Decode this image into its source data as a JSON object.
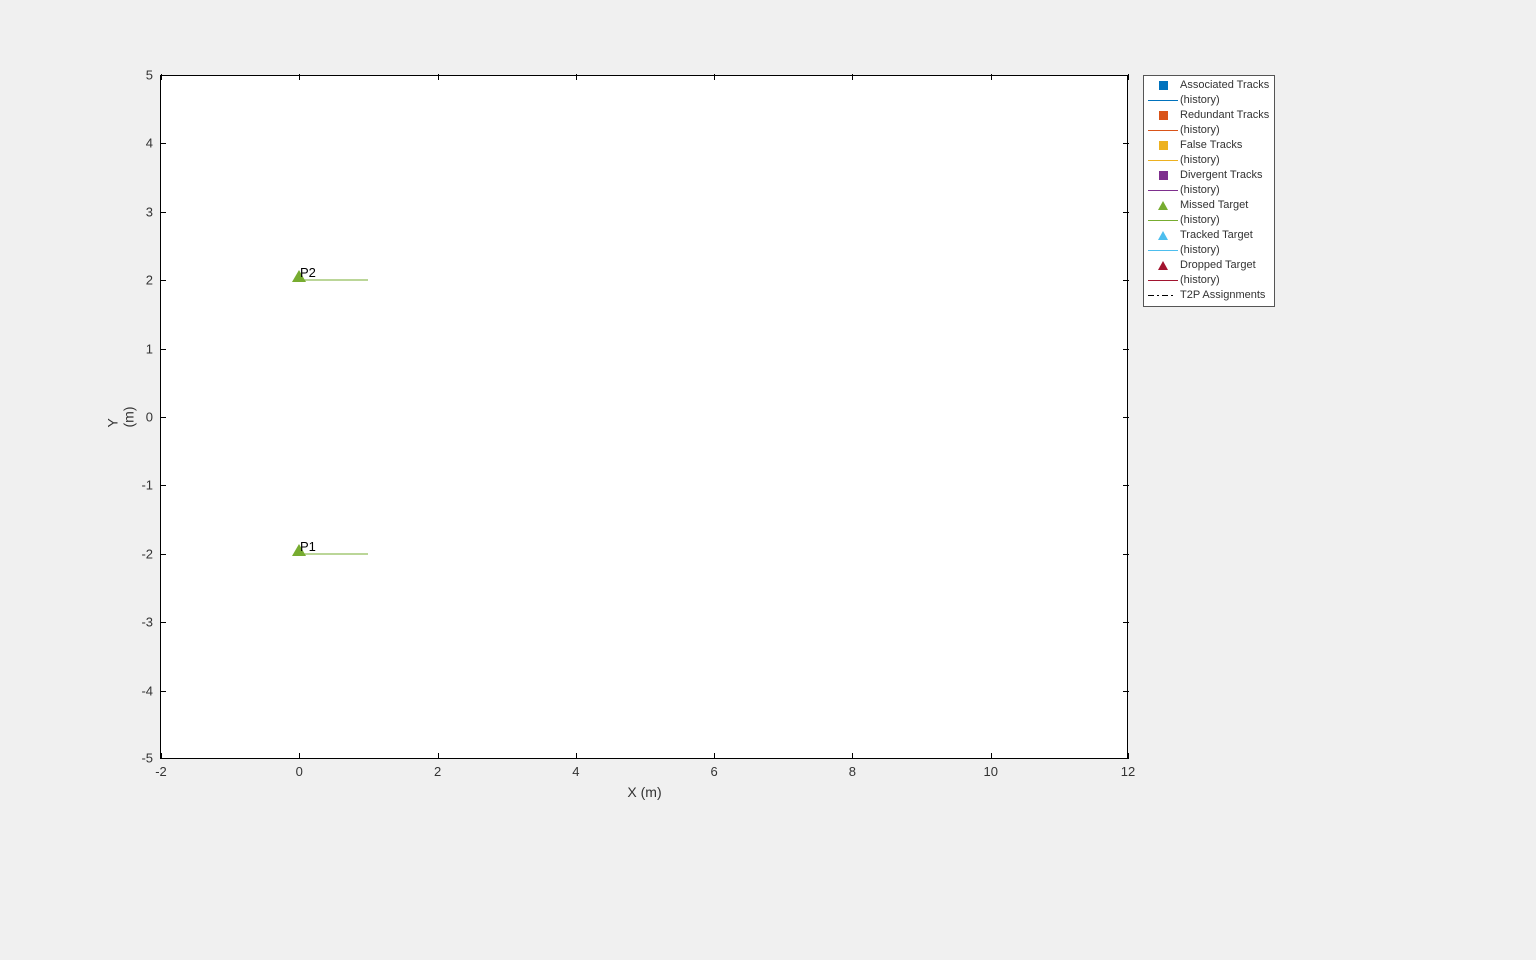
{
  "chart_data": {
    "type": "scatter",
    "xlabel": "X (m)",
    "ylabel": "Y (m)",
    "xlim": [
      -2,
      12
    ],
    "ylim": [
      -5,
      5
    ],
    "xticks": [
      -2,
      0,
      2,
      4,
      6,
      8,
      10,
      12
    ],
    "yticks": [
      -5,
      -4,
      -3,
      -2,
      -1,
      0,
      1,
      2,
      3,
      4,
      5
    ],
    "series": [
      {
        "name": "Missed Target",
        "marker": "triangle",
        "color": "#77ac30",
        "points": [
          {
            "x": 0,
            "y": 2,
            "label": "P2"
          },
          {
            "x": 0,
            "y": -2,
            "label": "P1"
          }
        ]
      },
      {
        "name": "Missed Target (history)",
        "type": "line",
        "color": "#77ac30",
        "segments": [
          {
            "x0": 0,
            "y0": 2,
            "x1": 1,
            "y1": 2
          },
          {
            "x0": 0,
            "y0": -2,
            "x1": 1,
            "y1": -2
          }
        ]
      }
    ],
    "legend": [
      {
        "marker": "square",
        "color": "#0072bd",
        "label": "Associated Tracks"
      },
      {
        "marker": "line",
        "color": "#0072bd",
        "label": "(history)"
      },
      {
        "marker": "square",
        "color": "#d95319",
        "label": "Redundant Tracks"
      },
      {
        "marker": "line",
        "color": "#d95319",
        "label": "(history)"
      },
      {
        "marker": "square",
        "color": "#edb120",
        "label": "False Tracks"
      },
      {
        "marker": "line",
        "color": "#edb120",
        "label": "(history)"
      },
      {
        "marker": "square",
        "color": "#7e2f8e",
        "label": "Divergent Tracks"
      },
      {
        "marker": "line",
        "color": "#7e2f8e",
        "label": "(history)"
      },
      {
        "marker": "triangle",
        "color": "#77ac30",
        "label": "Missed Target"
      },
      {
        "marker": "line",
        "color": "#77ac30",
        "label": "(history)"
      },
      {
        "marker": "triangle",
        "color": "#4dbeee",
        "label": "Tracked Target"
      },
      {
        "marker": "line",
        "color": "#4dbeee",
        "label": "(history)"
      },
      {
        "marker": "triangle",
        "color": "#a2142f",
        "label": "Dropped Target"
      },
      {
        "marker": "line",
        "color": "#a2142f",
        "label": "(history)"
      },
      {
        "marker": "dashdot",
        "color": "#000000",
        "label": "T2P Assignments"
      }
    ]
  },
  "labels": {
    "xlabel": "X (m)",
    "ylabel": "Y (m)",
    "p1": "P1",
    "p2": "P2",
    "xticks": {
      "n2": "-2",
      "0": "0",
      "2": "2",
      "4": "4",
      "6": "6",
      "8": "8",
      "10": "10",
      "12": "12"
    },
    "yticks": {
      "n5": "-5",
      "n4": "-4",
      "n3": "-3",
      "n2": "-2",
      "n1": "-1",
      "0": "0",
      "1": "1",
      "2": "2",
      "3": "3",
      "4": "4",
      "5": "5"
    },
    "legend": {
      "l0": "Associated Tracks",
      "l1": "(history)",
      "l2": "Redundant Tracks",
      "l3": "(history)",
      "l4": "False Tracks",
      "l5": "(history)",
      "l6": "Divergent Tracks",
      "l7": "(history)",
      "l8": "Missed Target",
      "l9": "(history)",
      "l10": "Tracked Target",
      "l11": "(history)",
      "l12": "Dropped Target",
      "l13": "(history)",
      "l14": "T2P Assignments"
    }
  }
}
